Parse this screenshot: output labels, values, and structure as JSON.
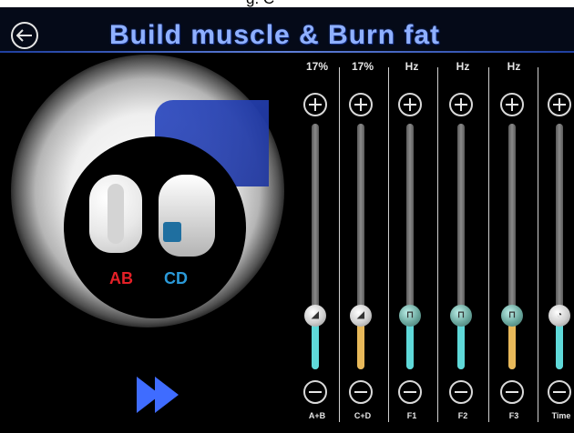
{
  "top_caption": "g. C",
  "header": {
    "title": "Build muscle & Burn fat"
  },
  "electrodes": {
    "ab_label": "AB",
    "cd_label": "CD"
  },
  "sliders": [
    {
      "value": "17%",
      "label": "A+B",
      "level": 0.22,
      "fill_color": "#5fd9d9",
      "knob": "ramp"
    },
    {
      "value": "17%",
      "label": "C+D",
      "level": 0.22,
      "fill_color": "#e8b95a",
      "knob": "ramp"
    },
    {
      "value": "Hz",
      "label": "F1",
      "level": 0.22,
      "fill_color": "#5fd9d9",
      "knob": "pulse"
    },
    {
      "value": "Hz",
      "label": "F2",
      "level": 0.22,
      "fill_color": "#5fd9d9",
      "knob": "pulse"
    },
    {
      "value": "Hz",
      "label": "F3",
      "level": 0.22,
      "fill_color": "#e8b95a",
      "knob": "pulse"
    },
    {
      "value": "",
      "label": "Time",
      "level": 0.22,
      "fill_color": "#5fd9d9",
      "knob": "clock"
    }
  ],
  "colors": {
    "accent": "#3f6cff",
    "title_color": "#8fb0ff",
    "ab_color": "#e42027",
    "cd_color": "#2b9ad9"
  }
}
